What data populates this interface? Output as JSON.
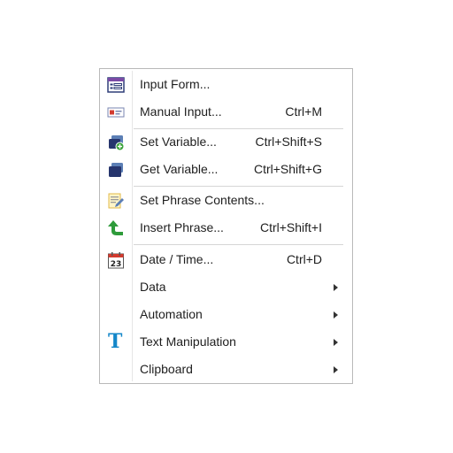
{
  "menu": {
    "items": [
      {
        "label": "Input Form...",
        "shortcut": "",
        "icon": "input-form-icon"
      },
      {
        "label": "Manual Input...",
        "shortcut": "Ctrl+M",
        "icon": "manual-input-icon"
      },
      {
        "label": "Set Variable...",
        "shortcut": "Ctrl+Shift+S",
        "icon": "set-variable-icon"
      },
      {
        "label": "Get Variable...",
        "shortcut": "Ctrl+Shift+G",
        "icon": "get-variable-icon"
      },
      {
        "label": "Set Phrase Contents...",
        "shortcut": "",
        "icon": "set-phrase-contents-icon"
      },
      {
        "label": "Insert Phrase...",
        "shortcut": "Ctrl+Shift+I",
        "icon": "insert-phrase-icon"
      },
      {
        "label": "Date / Time...",
        "shortcut": "Ctrl+D",
        "icon": "calendar-icon",
        "icon_text": "23"
      },
      {
        "label": "Data",
        "shortcut": "",
        "icon": ""
      },
      {
        "label": "Automation",
        "shortcut": "",
        "icon": ""
      },
      {
        "label": "Text Manipulation",
        "shortcut": "",
        "icon": "text-manipulation-icon",
        "icon_text": "T"
      },
      {
        "label": "Clipboard",
        "shortcut": "",
        "icon": ""
      }
    ]
  },
  "colors": {
    "accent_blue": "#1487c9",
    "navy": "#26356d",
    "purple": "#7b4aa6",
    "green": "#3aa23a",
    "calendar_red": "#d23b2f"
  }
}
